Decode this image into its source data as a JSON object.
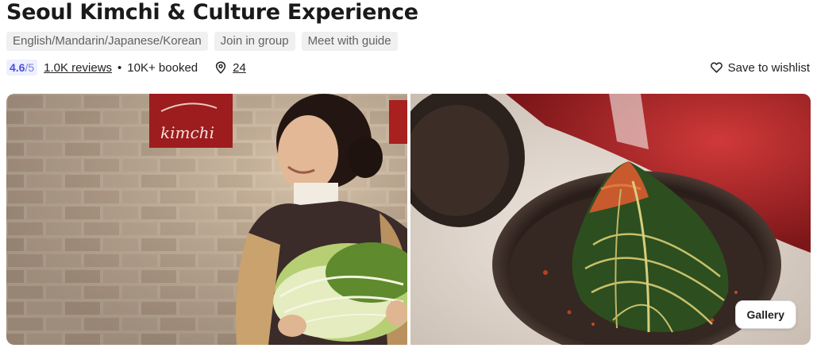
{
  "title": "Seoul Kimchi & Culture Experience",
  "tags": [
    "English/Mandarin/Japanese/Korean",
    "Join in group",
    "Meet with guide"
  ],
  "rating": {
    "score": "4.6",
    "max": "/5"
  },
  "reviews_label": "1.0K reviews",
  "separator": "•",
  "booked_label": "10K+ booked",
  "location_count": "24",
  "wishlist_label": "Save to wishlist",
  "gallery_label": "Gallery",
  "sign_text": "kimchi",
  "colors": {
    "accent": "#4b4fd6",
    "rating_bg": "#eef0ff",
    "tag_bg": "#f0f0f0"
  }
}
